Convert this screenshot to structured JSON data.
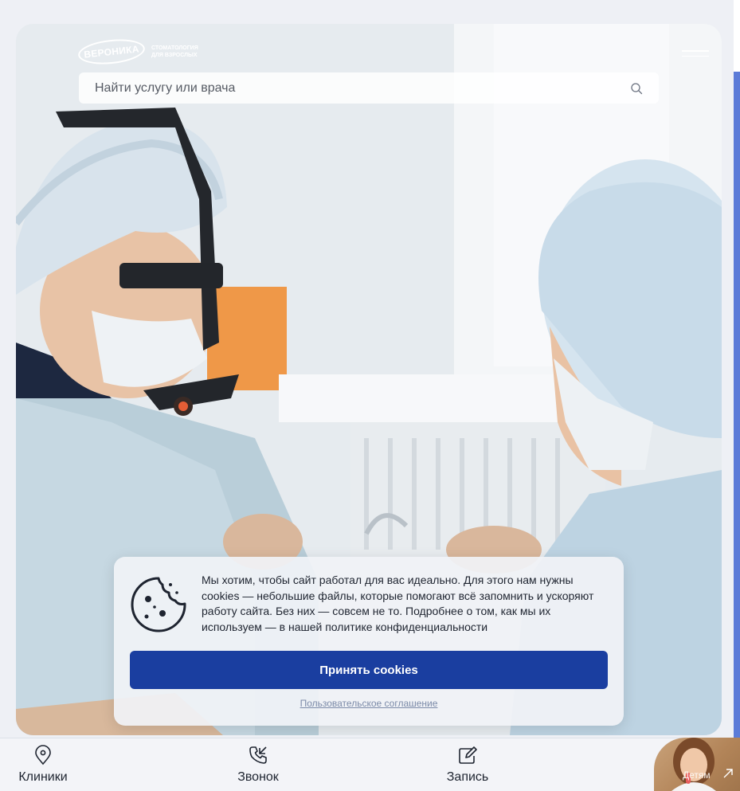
{
  "header": {
    "logo_name": "ВЕРОНИКА",
    "logo_sub_line1": "СТОМАТОЛОГИЯ",
    "logo_sub_line2": "ДЛЯ ВЗРОСЛЫХ",
    "menu_icon": "hamburger-icon"
  },
  "search": {
    "placeholder": "Найти услугу или врача",
    "icon": "search-icon"
  },
  "cookie_banner": {
    "text": "Мы хотим, чтобы сайт работал для вас идеально. Для этого нам нужны cookies — небольшие файлы, которые помогают всё запомнить и ускоряют работу сайта. Без них — совсем не то. Подробнее о том, как мы их используем — в нашей политике конфиденциальности",
    "accept_label": "Принять cookies",
    "agreement_label": "Пользовательское соглашение",
    "icon": "cookie-icon"
  },
  "bottom_nav": {
    "items": [
      {
        "label": "Клиники",
        "icon": "location-pin-icon"
      },
      {
        "label": "Звонок",
        "icon": "phone-icon"
      },
      {
        "label": "Запись",
        "icon": "edit-icon"
      }
    ],
    "kids_label": "Детям",
    "kids_icon": "arrow-up-right-icon"
  },
  "colors": {
    "accent": "#1a3ea0",
    "background": "#eef0f5",
    "text": "#1e2430"
  }
}
